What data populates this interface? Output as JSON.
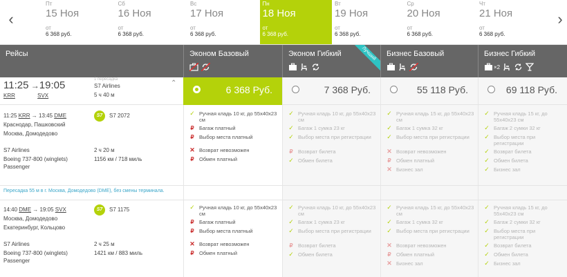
{
  "nav": {
    "prev_icon": "chevron-left-icon",
    "next_icon": "chevron-right-icon"
  },
  "days": [
    {
      "dow": "Пт",
      "date": "15 Ноя",
      "from": "от",
      "price": "6 368 руб.",
      "active": false
    },
    {
      "dow": "Сб",
      "date": "16 Ноя",
      "from": "от",
      "price": "6 368 руб.",
      "active": false
    },
    {
      "dow": "Вс",
      "date": "17 Ноя",
      "from": "от",
      "price": "6 368 руб.",
      "active": false
    },
    {
      "dow": "Пн",
      "date": "18 Ноя",
      "from": "от",
      "price": "6 368 руб.",
      "active": true
    },
    {
      "dow": "Вт",
      "date": "19 Ноя",
      "from": "от",
      "price": "6 368 руб.",
      "active": false
    },
    {
      "dow": "Ср",
      "date": "20 Ноя",
      "from": "от",
      "price": "6 368 руб.",
      "active": false
    },
    {
      "dow": "Чт",
      "date": "21 Ноя",
      "from": "от",
      "price": "6 368 руб.",
      "active": false
    }
  ],
  "header": {
    "flights_label": "Рейсы",
    "fares": [
      {
        "name": "Эконом Базовый",
        "icons": [
          "no-baggage-icon",
          "no-exchange-icon"
        ]
      },
      {
        "name": "Эконом Гибкий",
        "icons": [
          "baggage-icon",
          "seat-icon",
          "exchange-icon"
        ],
        "badge": "Лучший"
      },
      {
        "name": "Бизнес Базовый",
        "icons": [
          "baggage-icon",
          "seat-icon",
          "no-exchange-icon"
        ]
      },
      {
        "name": "Бизнес Гибкий",
        "icons": [
          "baggage-x2-icon",
          "seat-icon",
          "exchange-icon",
          "lounge-icon"
        ],
        "baggage_count": "×2"
      }
    ]
  },
  "summary": {
    "dep_time": "11:25",
    "arr_time": "19:05",
    "from_code": "KRR",
    "to_code": "SVX",
    "note": "1 пересадка",
    "airline": "S7 Airlines",
    "duration": "5 ч 40 м",
    "prices": [
      "6 368 Руб.",
      "7 368 Руб.",
      "55 118 Руб.",
      "69 118 Руб."
    ],
    "selected_index": 0
  },
  "segments": [
    {
      "route_pre": "11:25",
      "from_code": "KRR",
      "route_mid": "→ 13:45",
      "to_code": "DME",
      "city1": "Краснодар, Пашковский",
      "city2": "Москва, Домодедово",
      "airline": "S7 Airlines",
      "aircraft": "Boeing 737-800 (winglets)",
      "cabin": "Passenger",
      "logo": "S7",
      "flight_no": "S7 2072",
      "duration": "2 ч 20 м",
      "distance": "1156 км / 718 миль"
    },
    {
      "route_pre": "14:40",
      "from_code": "DME",
      "route_mid": "→ 19:05",
      "to_code": "SVX",
      "city1": "Москва, Домодедово",
      "city2": "Екатеринбург, Кольцово",
      "airline": "S7 Airlines",
      "aircraft": "Boeing 737-800 (winglets)",
      "cabin": "Passenger",
      "logo": "S7",
      "flight_no": "S7 1175",
      "duration": "2 ч 25 м",
      "distance": "1421 км / 883 миль"
    }
  ],
  "transfer": "Пересадка 55 м в г. Москва, Домодедово (DME), без смены терминала.",
  "features": [
    [
      {
        "icon": "check",
        "text": "Ручная кладь 10 кг, до 55x40x23 см"
      },
      {
        "icon": "rub",
        "text": "Багаж платный"
      },
      {
        "icon": "rub",
        "text": "Выбор места платный"
      },
      {
        "icon": "cross",
        "text": "Возврат невозможен"
      },
      {
        "icon": "rub",
        "text": "Обмен платный"
      }
    ],
    [
      {
        "icon": "check",
        "text": "Ручная кладь 10 кг, до 55x40x23 см"
      },
      {
        "icon": "check",
        "text": "Багаж 1 сумка 23 кг"
      },
      {
        "icon": "check",
        "text": "Выбор места при регистрации"
      },
      {
        "icon": "rub",
        "text": "Возврат билета"
      },
      {
        "icon": "check",
        "text": "Обмен билета"
      }
    ],
    [
      {
        "icon": "check",
        "text": "Ручная кладь 15 кг, до 55x40x23 см"
      },
      {
        "icon": "check",
        "text": "Багаж 1 сумка 32 кг"
      },
      {
        "icon": "check",
        "text": "Выбор места при регистрации"
      },
      {
        "icon": "cross",
        "text": "Возврат невозможен"
      },
      {
        "icon": "rub",
        "text": "Обмен платный"
      },
      {
        "icon": "cross",
        "text": "Бизнес зал"
      }
    ],
    [
      {
        "icon": "check",
        "text": "Ручная кладь 15 кг, до 55x40x23 см"
      },
      {
        "icon": "check",
        "text": "Багаж 2 сумки 32 кг"
      },
      {
        "icon": "check",
        "text": "Выбор места при регистрации"
      },
      {
        "icon": "check",
        "text": "Возврат билета"
      },
      {
        "icon": "check",
        "text": "Обмен билета"
      },
      {
        "icon": "check",
        "text": "Бизнес зал"
      }
    ]
  ],
  "colors": {
    "accent": "#b4d20a",
    "header_bg": "#666666",
    "badge": "#2ec3c3",
    "link": "#3aa6c9",
    "danger": "#c92a2a"
  }
}
